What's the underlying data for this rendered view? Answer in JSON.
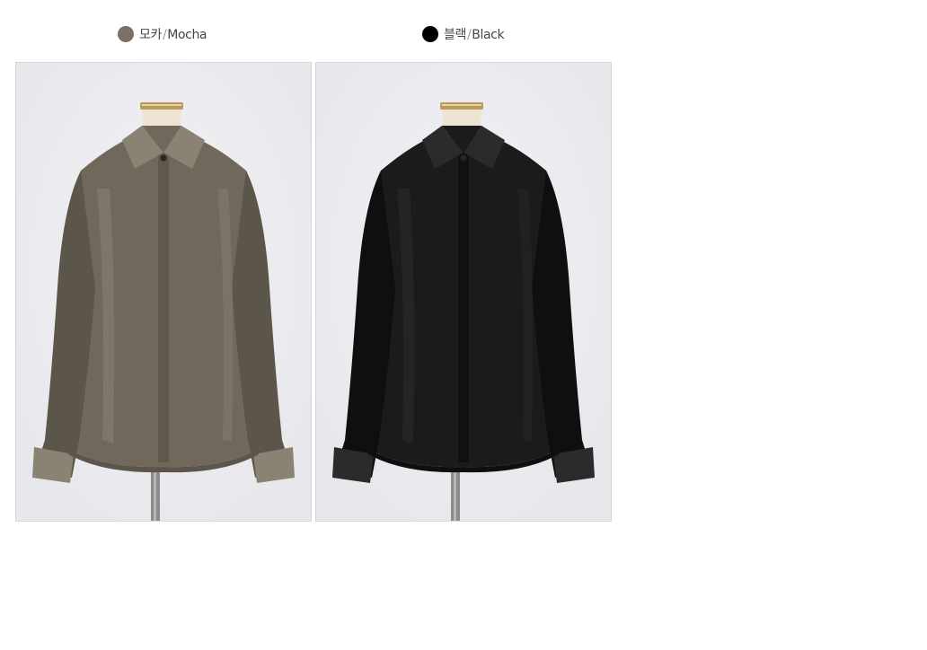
{
  "colors": {
    "background": "#ffffff",
    "backdrop": "#e8e7ec",
    "mannequin": "#efe3d4",
    "brass": "#b89a5a",
    "stand": "#8b8b8b"
  },
  "options": [
    {
      "swatch_color": "#7b7064",
      "korean_name": "모카",
      "separator": "/",
      "english_name": "Mocha",
      "garment_color": "#6f685b",
      "garment_shade": "#5b554a",
      "garment_light": "#8a8273",
      "photo_icon": "mocha-shirt-photo"
    },
    {
      "swatch_color": "#000000",
      "korean_name": "블랙",
      "separator": "/",
      "english_name": "Black",
      "garment_color": "#1b1b1b",
      "garment_shade": "#0f0f0f",
      "garment_light": "#2b2b2b",
      "photo_icon": "black-shirt-photo"
    }
  ]
}
